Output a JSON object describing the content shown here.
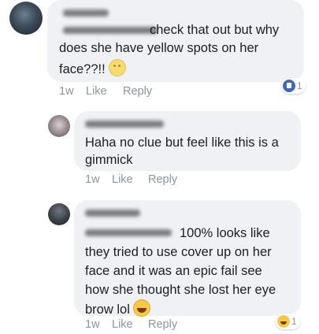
{
  "comments": [
    {
      "lines": [
        "check that out but why",
        "does she have yellow spots on her",
        "face??!!"
      ],
      "time": "1w",
      "like_label": "Like",
      "reply_label": "Reply",
      "reaction": {
        "icon": "like-icon",
        "count": "1"
      }
    },
    {
      "lines": [
        "Haha no clue but feel like this is a",
        "gimmick"
      ],
      "time": "1w",
      "like_label": "Like",
      "reply_label": "Reply"
    },
    {
      "lines": [
        "100% looks like",
        "they tried to use cover up on her",
        "face and it was an epic fail see",
        "how she thought she lost her eye",
        "brow lol"
      ],
      "time": "1w",
      "like_label": "Like",
      "reply_label": "Reply",
      "reaction": {
        "icon": "haha-icon",
        "count": "1"
      }
    }
  ],
  "colors": {
    "bubble": "#f0f1f4",
    "text": "#1c1e21",
    "meta": "#8d949e",
    "like_blue": "#4267b2"
  }
}
